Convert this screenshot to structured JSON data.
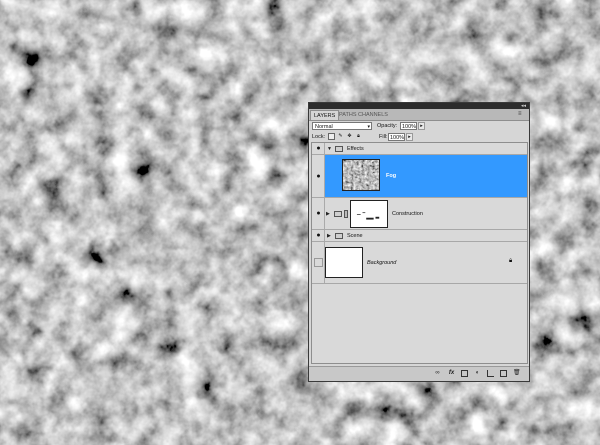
{
  "panel": {
    "tabs": [
      "LAYERS",
      "PATHS",
      "CHANNELS"
    ],
    "active_tab": "LAYERS",
    "blend_mode": "Normal",
    "opacity_label": "Opacity:",
    "opacity_value": "100%",
    "lock_label": "Lock:",
    "fill_label": "Fill:",
    "fill_value": "100%"
  },
  "layers": [
    {
      "name": "Effects",
      "kind": "group",
      "expanded": true,
      "visible": true
    },
    {
      "name": "Fog",
      "kind": "pixel",
      "selected": true,
      "visible": true
    },
    {
      "name": "Construction",
      "kind": "group-with-mask",
      "expanded": false,
      "visible": true
    },
    {
      "name": "Scene",
      "kind": "group",
      "expanded": false,
      "visible": true
    },
    {
      "name": "Background",
      "kind": "background",
      "locked": true,
      "visible": false
    }
  ],
  "bottom_icons": [
    "link-icon",
    "fx-icon",
    "mask-icon",
    "adjustment-icon",
    "group-icon",
    "new-layer-icon",
    "trash-icon"
  ],
  "colors": {
    "selection": "#3399ff",
    "panel_bg": "#d6d6d6"
  }
}
